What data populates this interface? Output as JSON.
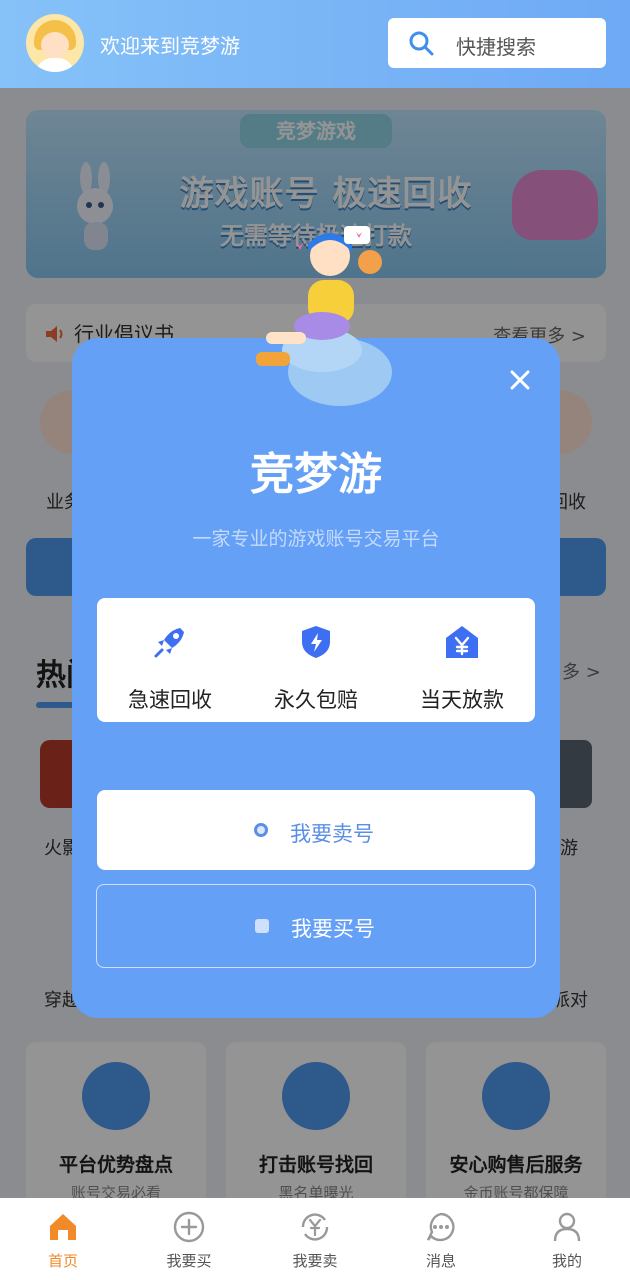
{
  "header": {
    "welcome": "欢迎来到竞梦游",
    "search_placeholder": "快捷搜索"
  },
  "banner": {
    "tag": "竞梦游戏",
    "headline": "游戏账号 极速回收",
    "subline": "无需等待极速打款"
  },
  "notice": {
    "text": "行业倡议书",
    "more": "查看更多 >"
  },
  "quick_row": {
    "left_label": "业务",
    "right_label": "回收"
  },
  "hot": {
    "title": "热门",
    "more": "多 >"
  },
  "games": {
    "r1_left": "火影",
    "r1_right": "游",
    "r2_left": "穿越",
    "r2_right": "派对"
  },
  "cards": [
    {
      "title": "平台优势盘点",
      "subtitle": "账号交易必看",
      "icon": "trophy-icon"
    },
    {
      "title": "打击账号找回",
      "subtitle": "黑名单曝光",
      "icon": "pen-icon"
    },
    {
      "title": "安心购售后服务",
      "subtitle": "金币账号都保障",
      "icon": "headset-icon"
    }
  ],
  "modal": {
    "brand": "竞梦游",
    "slogan": "一家专业的游戏账号交易平台",
    "features": [
      {
        "label": "急速回收",
        "icon": "rocket-icon"
      },
      {
        "label": "永久包赔",
        "icon": "shield-icon"
      },
      {
        "label": "当天放款",
        "icon": "yen-house-icon"
      }
    ],
    "sell_button": "我要卖号",
    "buy_button": "我要买号"
  },
  "tabbar": {
    "items": [
      {
        "label": "首页",
        "icon": "home-icon",
        "active": true
      },
      {
        "label": "我要买",
        "icon": "plus-circle-icon",
        "active": false
      },
      {
        "label": "我要卖",
        "icon": "yen-cycle-icon",
        "active": false
      },
      {
        "label": "消息",
        "icon": "chat-icon",
        "active": false
      },
      {
        "label": "我的",
        "icon": "user-icon",
        "active": false
      }
    ]
  },
  "colors": {
    "header_start": "#86c2f8",
    "modal_bg": "#65a0f7",
    "accent_blue": "#4f9bf0",
    "active_tab": "#f28a2a"
  }
}
